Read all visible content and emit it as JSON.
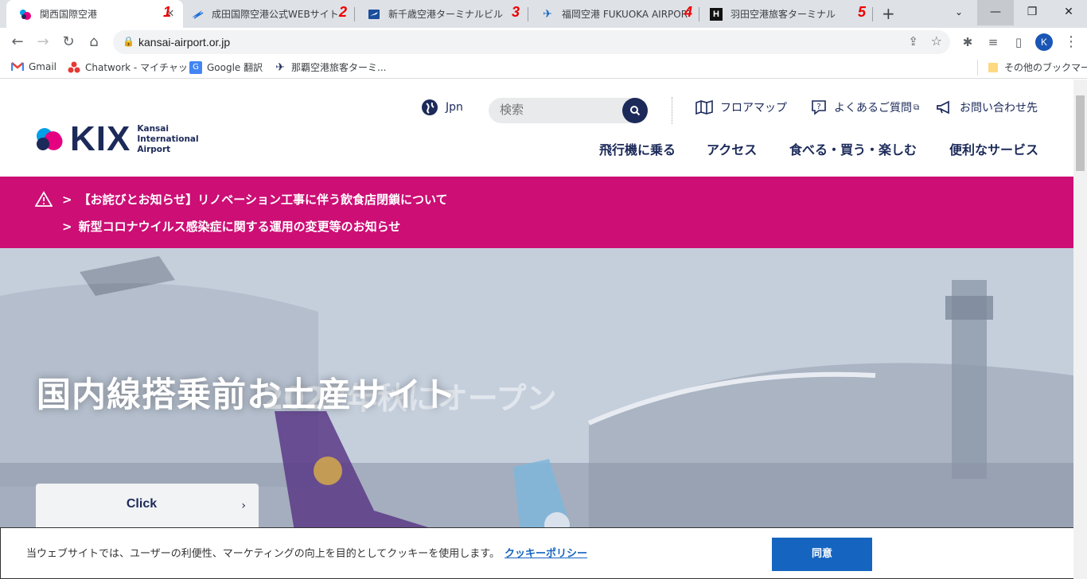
{
  "browser": {
    "tabs": [
      {
        "title": "関西国際空港",
        "marker": "1"
      },
      {
        "title": "成田国際空港公式WEBサイト",
        "marker": "2"
      },
      {
        "title": "新千歳空港ターミナルビル",
        "marker": "3"
      },
      {
        "title": "福岡空港 FUKUOKA AIRPORT",
        "marker": "4"
      },
      {
        "title": "羽田空港旅客ターミナル",
        "marker": "5"
      }
    ],
    "new_tab_icon": "+",
    "url": "kansai-airport.or.jp",
    "profile_initial": "K",
    "bookmarks": [
      {
        "label": "Gmail",
        "icon": "gmail-icon"
      },
      {
        "label": "Chatwork - マイチャット",
        "icon": "chatwork-icon"
      },
      {
        "label": "Google 翻訳",
        "icon": "google-translate-icon"
      },
      {
        "label": "那覇空港旅客ターミ...",
        "icon": "airplane-icon"
      }
    ],
    "other_bookmarks": "その他のブックマーク"
  },
  "site": {
    "logo_text": "KIX",
    "logo_sub": [
      "Kansai",
      "International",
      "Airport"
    ],
    "language": "Jpn",
    "search_placeholder": "検索",
    "utility_links": [
      {
        "label": "フロアマップ",
        "icon": "map-icon"
      },
      {
        "label": "よくあるご質問",
        "icon": "question-icon"
      },
      {
        "label": "お問い合わせ先",
        "icon": "megaphone-icon"
      }
    ],
    "main_nav": [
      "飛行機に乗る",
      "アクセス",
      "食べる・買う・楽しむ",
      "便利なサービス"
    ],
    "alerts": [
      "【お詫びとお知らせ】リノベーション工事に伴う飲食店閉鎖について",
      "新型コロナウイルス感染症に関する運用の変更等のお知らせ"
    ],
    "hero": {
      "title": "国内線搭乗前お土産サイト",
      "ghost_text": "2022年秋にオープン",
      "cta_label": "Click",
      "cta_arrow": "›"
    }
  },
  "cookie": {
    "message": "当ウェブサイトでは、ユーザーの利便性、マーケティングの向上を目的としてクッキーを使用します。",
    "policy_link": "クッキーポリシー",
    "agree": "同意"
  },
  "colors": {
    "brand_navy": "#1c2a5a",
    "alert_magenta": "#cc0e75",
    "cookie_button": "#1565c0",
    "tab_marker_red": "#e00000"
  }
}
